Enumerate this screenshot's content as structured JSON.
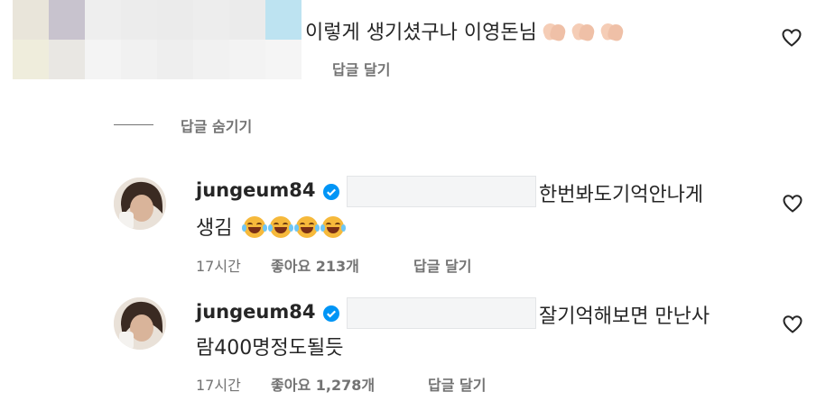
{
  "top_comment": {
    "text": "이렇게 생기셨구나 이영돈님",
    "emoji": [
      "clapping-hands",
      "clapping-hands",
      "clapping-hands"
    ],
    "reply_label": "답글 달기"
  },
  "hide_replies_label": "답글 숨기기",
  "replies": [
    {
      "username": "jungeum84",
      "verified": true,
      "text_line1": "한번봐도기억안나게",
      "text_line2": "생김",
      "emoji": [
        "rolling-laughing-face",
        "rolling-laughing-face",
        "rolling-laughing-face",
        "rolling-laughing-face"
      ],
      "time": "17시간",
      "likes": "좋아요 213개",
      "reply_label": "답글 달기"
    },
    {
      "username": "jungeum84",
      "verified": true,
      "text_line1": "잘기억해보면 만난사",
      "text_line2": "람400명정도될듯",
      "time": "17시간",
      "likes": "좋아요 1,278개",
      "reply_label": "답글 달기"
    }
  ],
  "colors": {
    "text": "#262626",
    "secondary": "#737373",
    "verified_badge": "#0095f6"
  }
}
